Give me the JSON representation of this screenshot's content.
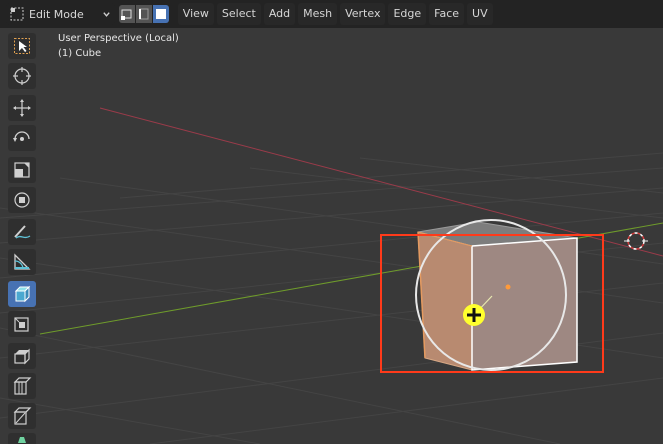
{
  "header": {
    "mode_label": "Edit Mode",
    "menus": [
      "View",
      "Select",
      "Add",
      "Mesh",
      "Vertex",
      "Edge",
      "Face",
      "UV"
    ]
  },
  "viewport": {
    "perspective_label": "User Perspective (Local)",
    "object_label": "(1) Cube"
  },
  "toolbar": {
    "tools": [
      {
        "name": "select-box-icon",
        "active": false
      },
      {
        "name": "cursor-icon",
        "active": false
      },
      {
        "name": "move-icon",
        "active": false
      },
      {
        "name": "rotate-icon",
        "active": false
      },
      {
        "name": "scale-icon",
        "active": false
      },
      {
        "name": "transform-icon",
        "active": false
      },
      {
        "name": "annotate-icon",
        "active": false
      },
      {
        "name": "measure-icon",
        "active": false
      },
      {
        "name": "add-cube-icon",
        "active": true
      },
      {
        "name": "extrude-region-icon",
        "active": false
      },
      {
        "name": "inset-faces-icon",
        "active": false
      },
      {
        "name": "bevel-icon",
        "active": false
      },
      {
        "name": "loop-cut-icon",
        "active": false
      },
      {
        "name": "knife-icon",
        "active": false
      }
    ]
  },
  "colors": {
    "active_tool": "#4772b3",
    "selection_box": "#ff3a1a",
    "x_axis": "#9b3b4a",
    "y_axis": "#6f9c2b",
    "cursor_yellow": "#ffff2e"
  }
}
